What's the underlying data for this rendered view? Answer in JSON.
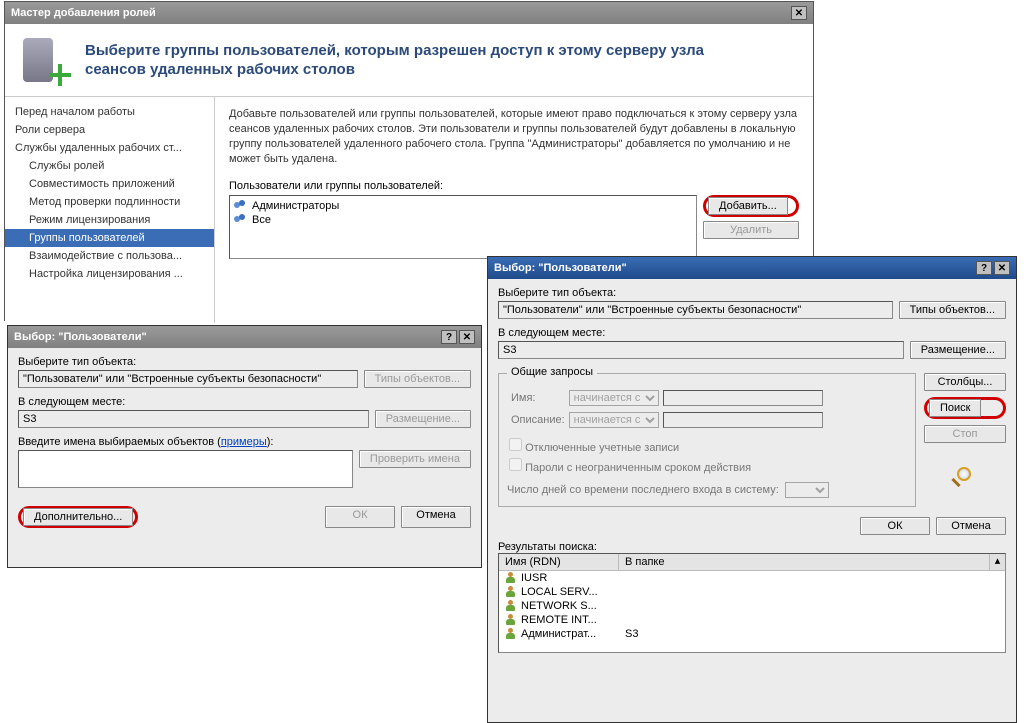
{
  "wizard": {
    "title": "Мастер добавления ролей",
    "heading": "Выберите группы пользователей, которым разрешен доступ к этому серверу узла сеансов удаленных рабочих столов",
    "nav": {
      "items": [
        "Перед началом работы",
        "Роли сервера",
        "Службы удаленных рабочих ст...",
        "Службы ролей",
        "Совместимость приложений",
        "Метод проверки подлинности",
        "Режим лицензирования",
        "Группы пользователей",
        "Взаимодействие с пользова...",
        "Настройка лицензирования ..."
      ],
      "selectedIndex": 7
    },
    "body": {
      "paragraph": "Добавьте пользователей или группы пользователей, которые имеют право подключаться к этому серверу узла сеансов удаленных рабочих столов. Эти пользователи и группы пользователей будут добавлены в локальную группу пользователей удаленного рабочего стола. Группа \"Администраторы\" добавляется по умолчанию и не может быть удалена.",
      "listLabel": "Пользователи или группы пользователей:",
      "listItems": [
        "Администраторы",
        "Все"
      ],
      "addBtn": "Добавить...",
      "removeBtn": "Удалить"
    }
  },
  "dlg1": {
    "title": "Выбор: \"Пользователи\"",
    "lblObjType": "Выберите тип объекта:",
    "objType": "\"Пользователи\" или \"Встроенные субъекты безопасности\"",
    "btnObjTypes": "Типы объектов...",
    "lblLocation": "В следующем месте:",
    "location": "S3",
    "btnLocation": "Размещение...",
    "lblNames": "Введите имена выбираемых объектов",
    "examples": "примеры",
    "btnCheckNames": "Проверить имена",
    "btnAdvanced": "Дополнительно...",
    "btnOK": "ОК",
    "btnCancel": "Отмена"
  },
  "dlg2": {
    "title": "Выбор: \"Пользователи\"",
    "lblObjType": "Выберите тип объекта:",
    "objType": "\"Пользователи\" или \"Встроенные субъекты безопасности\"",
    "btnObjTypes": "Типы объектов...",
    "lblLocation": "В следующем месте:",
    "location": "S3",
    "btnLocation": "Размещение...",
    "grpCommon": "Общие запросы",
    "lblName": "Имя:",
    "lblDesc": "Описание:",
    "comboOption": "начинается с",
    "chkDisabled": "Отключенные учетные записи",
    "chkNoExpire": "Пароли с неограниченным сроком действия",
    "lblDays": "Число дней со времени последнего входа в систему:",
    "btnCols": "Столбцы...",
    "btnSearch": "Поиск",
    "btnStop": "Стоп",
    "btnOK": "ОК",
    "btnCancel": "Отмена",
    "lblResults": "Результаты поиска:",
    "colName": "Имя (RDN)",
    "colFolder": "В папке",
    "results": [
      {
        "name": "IUSR",
        "folder": ""
      },
      {
        "name": "LOCAL SERV...",
        "folder": ""
      },
      {
        "name": "NETWORK S...",
        "folder": ""
      },
      {
        "name": "REMOTE INT...",
        "folder": ""
      },
      {
        "name": "Администрат...",
        "folder": "S3"
      }
    ]
  }
}
